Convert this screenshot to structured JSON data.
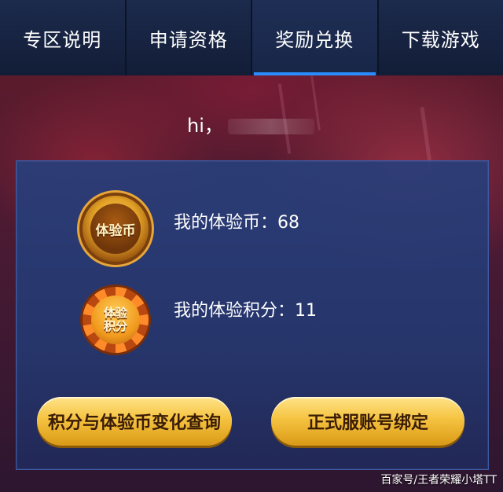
{
  "tabs": [
    {
      "label": "专区说明",
      "active": false
    },
    {
      "label": "申请资格",
      "active": false
    },
    {
      "label": "奖励兑换",
      "active": true
    },
    {
      "label": "下载游戏",
      "active": false
    }
  ],
  "greeting": {
    "prefix": "hi，"
  },
  "experience_coin": {
    "badge_text": "体验币",
    "label": "我的体验币：68",
    "value": 68
  },
  "experience_points": {
    "badge_line1": "体验",
    "badge_line2": "积分",
    "label": "我的体验积分：11",
    "value": 11
  },
  "buttons": {
    "query": "积分与体验币变化查询",
    "bind": "正式服账号绑定"
  },
  "watermark": "百家号/王者荣耀小塔TT",
  "colors": {
    "active_tab_underline": "#2a8dff",
    "button_gold": "#f5c340",
    "panel_blue": "#283e7a"
  }
}
